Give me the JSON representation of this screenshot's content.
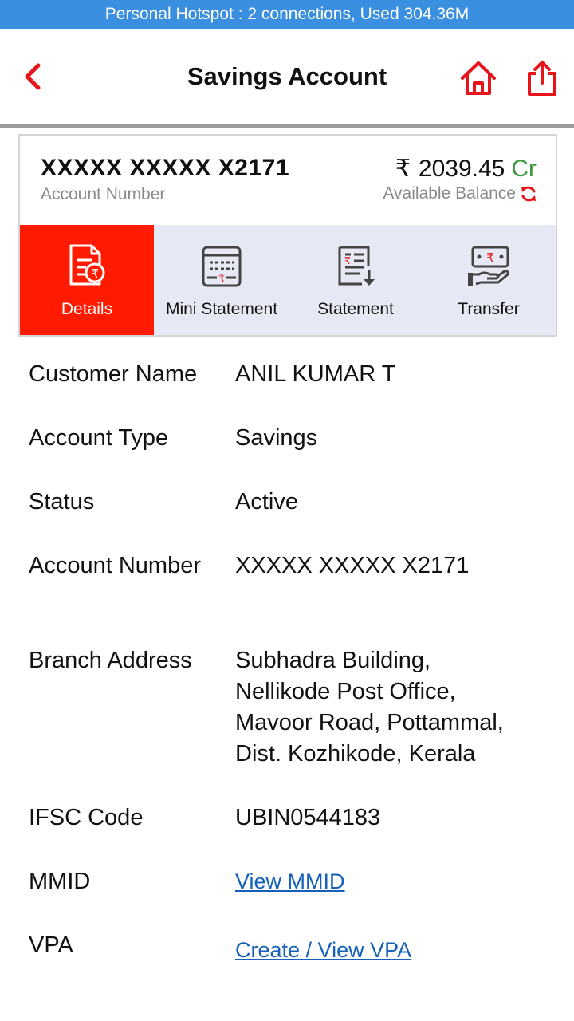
{
  "status_bar": {
    "text": "Personal Hotspot : 2 connections, Used 304.36M"
  },
  "header": {
    "title": "Savings Account",
    "back_icon": "chevron-left-icon",
    "home_icon": "home-icon",
    "share_icon": "share-icon"
  },
  "account": {
    "number": "XXXXX XXXXX X2171",
    "number_label": "Account Number",
    "currency_symbol": "₹",
    "balance": "2039.45",
    "balance_type": "Cr",
    "balance_label": "Available Balance"
  },
  "tabs": [
    {
      "label": "Details",
      "icon": "details-document-icon",
      "active": true
    },
    {
      "label": "Mini Statement",
      "icon": "mini-statement-icon",
      "active": false
    },
    {
      "label": "Statement",
      "icon": "statement-icon",
      "active": false
    },
    {
      "label": "Transfer",
      "icon": "transfer-money-icon",
      "active": false
    }
  ],
  "details": {
    "customer_name": {
      "label": "Customer Name",
      "value": "ANIL KUMAR T"
    },
    "account_type": {
      "label": "Account Type",
      "value": "Savings"
    },
    "status": {
      "label": "Status",
      "value": "Active"
    },
    "account_number": {
      "label": "Account Number",
      "value": "XXXXX XXXXX X2171"
    },
    "branch_address": {
      "label": "Branch Address",
      "lines": [
        "Subhadra Building,",
        "Nellikode Post Office,",
        "Mavoor Road, Pottammal,",
        "Dist. Kozhikode, Kerala"
      ]
    },
    "ifsc": {
      "label": "IFSC Code",
      "value": "UBIN0544183"
    },
    "mmid": {
      "label": "MMID",
      "link": "View MMID"
    },
    "vpa": {
      "label": "VPA",
      "link": "Create / View VPA"
    }
  },
  "colors": {
    "accent": "#ff1a00",
    "status_bar": "#3a8fe0",
    "credit_green": "#3a9a3a",
    "link_blue": "#1560b8",
    "tab_bg": "#e6e9f4"
  }
}
